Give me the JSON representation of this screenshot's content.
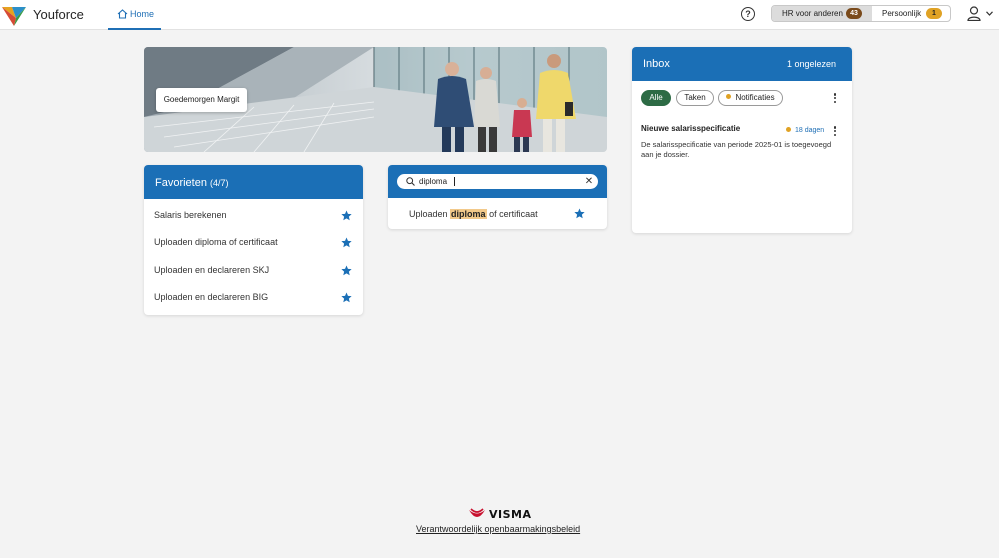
{
  "app": {
    "name": "Youforce"
  },
  "nav": {
    "home_label": "Home"
  },
  "header": {
    "hr_label": "HR voor anderen",
    "hr_count": "43",
    "persoonlijk_label": "Persoonlijk",
    "persoonlijk_count": "1",
    "help_symbol": "?",
    "icons": [
      "help-icon",
      "user-icon",
      "chevron-down-icon"
    ]
  },
  "hero": {
    "greeting": "Goedemorgen Margit"
  },
  "favorites": {
    "title": "Favorieten",
    "count": "(4/7)",
    "items": [
      {
        "label": "Salaris berekenen"
      },
      {
        "label": "Uploaden diploma of certificaat"
      },
      {
        "label": "Uploaden en declareren SKJ"
      },
      {
        "label": "Uploaden en declareren BIG"
      }
    ]
  },
  "search": {
    "value": "diploma",
    "clear_symbol": "✕",
    "result": {
      "prefix": "Uploaden ",
      "highlight": "diploma",
      "suffix": " of certificaat"
    }
  },
  "inbox": {
    "title": "Inbox",
    "unread": "1 ongelezen",
    "filters": [
      "Alle",
      "Taken",
      "Notificaties"
    ],
    "active_filter": "Alle",
    "message": {
      "title": "Nieuwe salarisspecificatie",
      "age": "18 dagen",
      "body": "De salarisspecificatie van periode 2025-01 is toegevoegd aan je dossier."
    }
  },
  "footer": {
    "logo_text": "VISMA",
    "link": "Verantwoordelijk openbaarmakingsbeleid"
  },
  "colors": {
    "primary": "#1b6fb6",
    "active_chip": "#2d6b45",
    "badge_hr": "#7a4a1b",
    "badge_persoonlijk": "#e0a224",
    "visma_red": "#c8102e"
  }
}
